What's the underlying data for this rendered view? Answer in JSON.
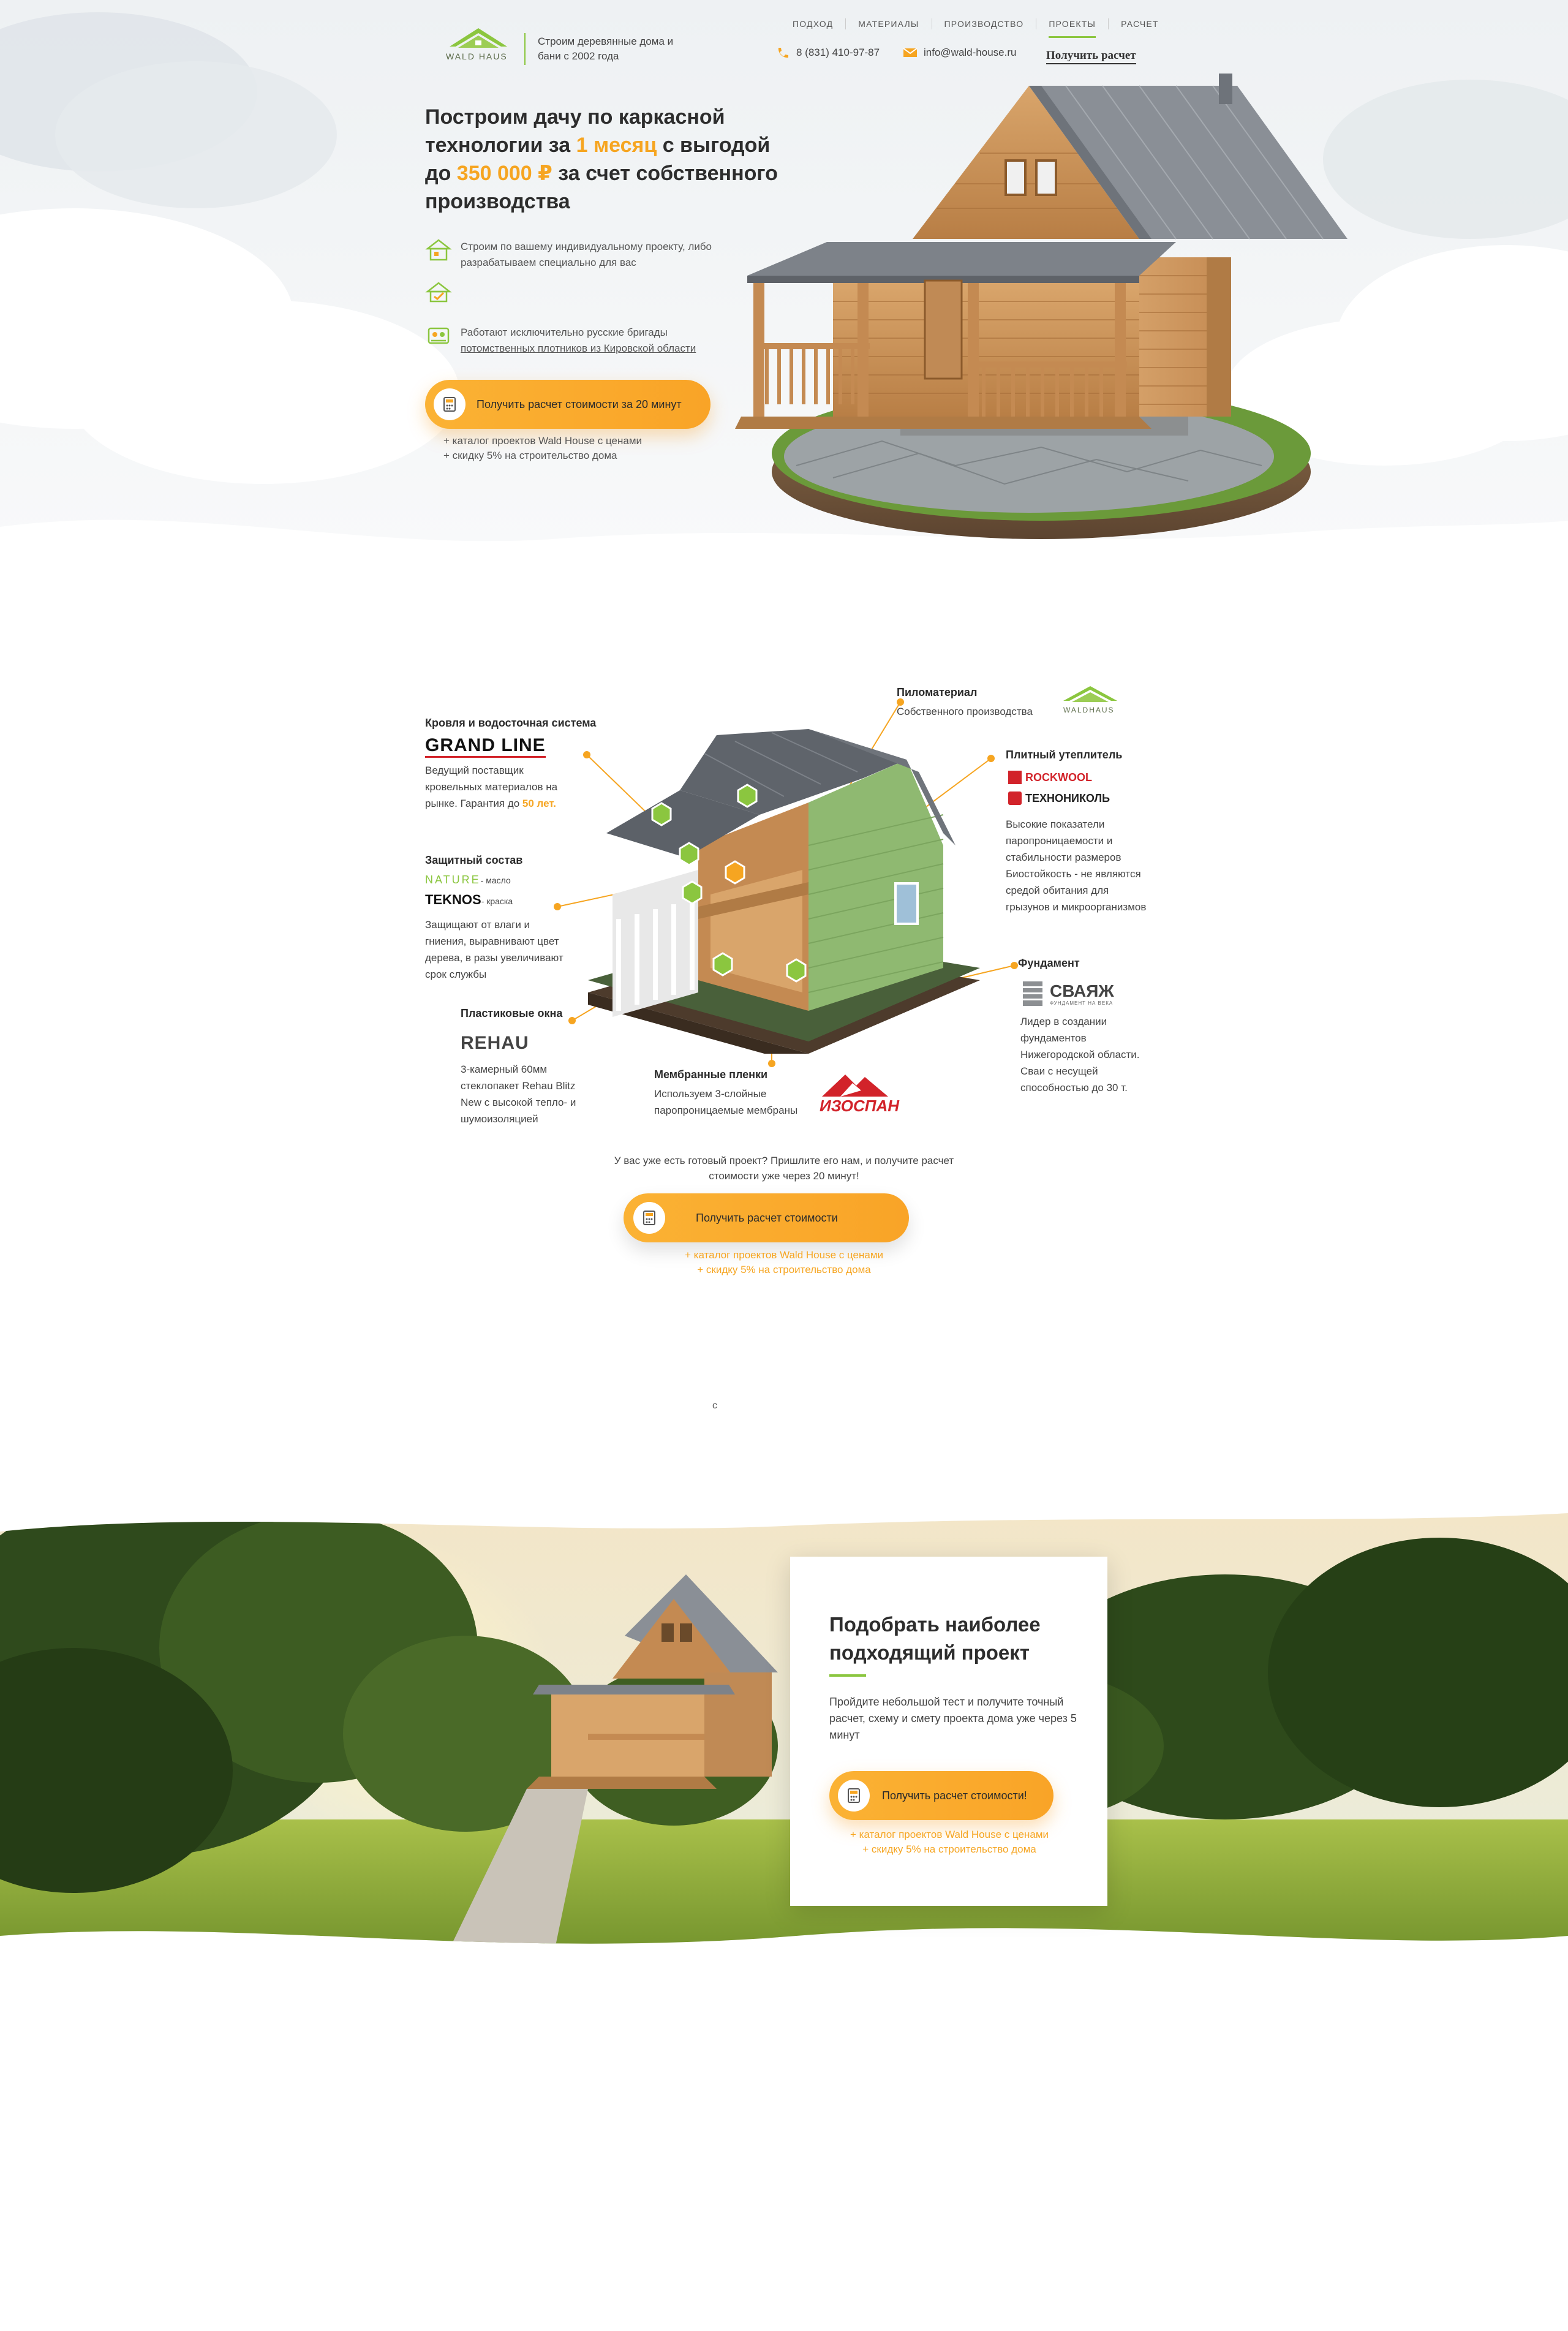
{
  "header": {
    "logo_text": "WALD HAUS",
    "tagline": "Строим деревянные дома и бани с 2002 года",
    "nav": [
      "ПОДХОД",
      "МАТЕРИАЛЫ",
      "ПРОИЗВОДСТВО",
      "ПРОЕКТЫ",
      "РАСЧЕТ"
    ],
    "nav_active": "ПРОЕКТЫ",
    "phone": "8 (831) 410-97-87",
    "email": "info@wald-house.ru",
    "calc_link": "Получить расчет"
  },
  "hero": {
    "title_1": "Построим дачу по каркасной технологии за ",
    "title_hl1": "1 месяц",
    "title_2": " с выгодой до ",
    "title_hl2": "350 000 ₽",
    "title_3": " за счет собственного производства",
    "features": [
      {
        "icon": "house-plan-icon",
        "text": "Строим по вашему индивидуальному проекту, либо разрабатываем специально для вас"
      },
      {
        "icon": "house-check-icon",
        "text": ""
      },
      {
        "icon": "workers-icon",
        "text_1": "Работают исключительно русские бригады",
        "text_2": "потомственных плотников из Кировской области"
      }
    ],
    "button": "Получить расчет стоимости за 20 минут",
    "bonus_1": "+ каталог проектов Wald House с ценами",
    "bonus_2": "+ скидку 5% на строительство дома"
  },
  "scheme": {
    "roof": {
      "title": "Кровля и водосточная система",
      "brand": "GRAND LINE",
      "text_1": "Ведущий поставщик кровельных материалов на рынке. Гарантия до ",
      "hl": "50 лет."
    },
    "protect": {
      "title": "Защитный состав",
      "brand1": "NATURE",
      "brand1_sfx": "- масло",
      "brand2": "TEKNOS",
      "brand2_sfx": "- краска",
      "text": "Защищают от влаги и гниения, выравнивают цвет дерева, в разы увеличивают срок службы"
    },
    "windows": {
      "title": "Пластиковые окна",
      "brand": "REHAU",
      "text": "3-камерный 60мм стеклопакет Rehau Blitz New с высокой тепло- и шумоизоляцией"
    },
    "membranes": {
      "title": "Мембранные пленки",
      "text": "Используем 3-слойные паропроницаемые мембраны",
      "brand": "ИЗОСПАН"
    },
    "lumber": {
      "title": "Пиломатериал",
      "text": "Собственного производства",
      "brand": "WALDHAUS"
    },
    "insulation": {
      "title": "Плитный утеплитель",
      "brand1": "ROCKWOOL",
      "brand2": "ТЕХНОНИКОЛЬ",
      "text": "Высокие показатели паропроницаемости и стабильности размеров Биостойкость - не являются средой обитания для грызунов и микроорганизмов"
    },
    "foundation": {
      "title": "Фундамент",
      "brand": "СВАЯЖ",
      "brand_sub": "ФУНДАМЕНТ НА ВЕКА",
      "text": "Лидер в создании фундаментов Нижегородской области. Сваи с несущей способностью до 30 т."
    },
    "question": "У вас уже есть готовый проект? Пришлите его нам, и получите расчет стоимости уже через 20 минут!",
    "button": "Получить расчет стоимости",
    "bonus_1": "+ каталог проектов Wald House с ценами",
    "bonus_2": "+ скидку 5% на строительство дома",
    "lone_char": "с"
  },
  "quiz": {
    "title": "Подобрать наиболее подходящий проект",
    "text": "Пройдите небольшой тест и получите точный расчет, схему и смету проекта дома уже через 5 минут",
    "button": "Получить расчет стоимости!",
    "bonus_1": "+ каталог проектов Wald House с ценами",
    "bonus_2": "+ скидку 5% на строительство дома"
  },
  "colors": {
    "accent": "#f6a521",
    "green": "#8bc63f",
    "text": "#2b2b2b"
  }
}
